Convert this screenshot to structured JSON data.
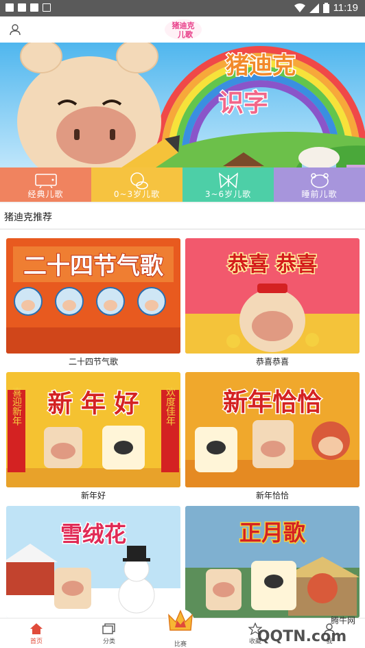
{
  "status_bar": {
    "time": "11:19"
  },
  "header": {
    "logo_text": "猪迪克儿歌"
  },
  "banner": {
    "title_line1": "猪迪克",
    "title_line2": "识字"
  },
  "categories": [
    {
      "label": "经典儿歌",
      "color": "#f0835f",
      "icon": "tv-icon"
    },
    {
      "label": "0~3岁儿歌",
      "color": "#f6c340",
      "icon": "baby-icon"
    },
    {
      "label": "3~6岁儿歌",
      "color": "#4dcfa7",
      "icon": "butterfly-icon"
    },
    {
      "label": "睡前儿歌",
      "color": "#a795dc",
      "icon": "moon-bear-icon"
    }
  ],
  "section": {
    "title": "猪迪克推荐"
  },
  "cards": [
    {
      "title": "二十四节气歌",
      "art_text": "二十四节气歌",
      "bg": "#e85a1f",
      "art_color": "#ffffff"
    },
    {
      "title": "恭喜恭喜",
      "art_text": "恭喜 恭喜",
      "bg": "#f2596d",
      "art_color": "#d41b1b"
    },
    {
      "title": "新年好",
      "art_text": "新 年 好",
      "bg": "#f5c231",
      "art_color": "#d42222",
      "side_left": "喜迎新年",
      "side_right": "欢度佳年"
    },
    {
      "title": "新年恰恰",
      "art_text": "新年恰恰",
      "bg": "#f0a82c",
      "art_color": "#d42222"
    },
    {
      "title": "雪绒花",
      "art_text": "雪绒花",
      "bg": "#bfe3f6",
      "art_color": "#e02a55"
    },
    {
      "title": "正月歌",
      "art_text": "正月歌",
      "bg": "#5c8f5a",
      "art_color": "#d42222"
    }
  ],
  "tabs": [
    {
      "label": "首页",
      "active": true
    },
    {
      "label": "分类",
      "active": false
    },
    {
      "label": "比赛",
      "active": false
    },
    {
      "label": "收藏",
      "active": false
    },
    {
      "label": "我",
      "active": false
    }
  ],
  "watermark": {
    "text1": "腾牛网",
    "text2": "QQTN.com"
  },
  "colors": {
    "accent": "#e04b3a",
    "statusbar": "#5a5a5a"
  }
}
